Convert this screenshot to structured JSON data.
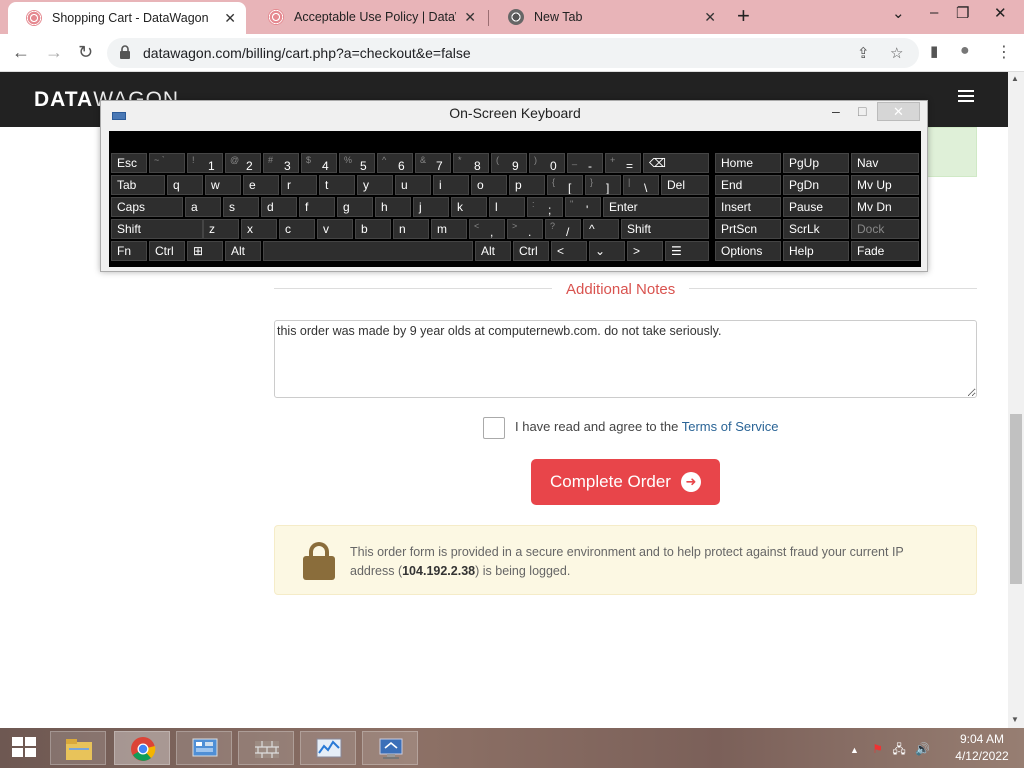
{
  "browser": {
    "tabs": [
      {
        "title": "Shopping Cart - DataWagon",
        "active": true
      },
      {
        "title": "Acceptable Use Policy | DataWa",
        "active": false
      },
      {
        "title": "New Tab",
        "active": false
      }
    ],
    "new_tab": "+",
    "window_controls": {
      "dropdown": "⌄",
      "minimize": "–",
      "restore": "❐",
      "close": "✕"
    },
    "nav": {
      "back": "←",
      "forward": "→",
      "reload": "↻"
    },
    "url": "datawagon.com/billing/cart.php?a=checkout&e=false",
    "omni_icons": {
      "share": "⇪",
      "star": "☆",
      "sidebar": "▮",
      "profile": "●",
      "menu": "⋮"
    },
    "tab_bar_color": "#e8b4b8"
  },
  "site": {
    "logo_a": "DATA",
    "logo_b": "WAGON",
    "notes_heading": "Additional Notes",
    "notes_value": "this order was made by 9 year olds at computernewb.com. do not take seriously.",
    "tos_text": "I have read and agree to the ",
    "tos_link": "Terms of Service",
    "complete_button": "Complete Order",
    "secure_prefix": "This order form is provided in a secure environment and to help protect against fraud your current IP address (",
    "ip_address": "104.192.2.38",
    "secure_suffix": ") is being logged.",
    "accent_color": "#e8454a",
    "heading_color": "#d9534f"
  },
  "osk": {
    "title": "On-Screen Keyboard",
    "controls": {
      "minimize": "–",
      "maximize": "□",
      "close": "✕"
    },
    "rows": [
      [
        {
          "l": "Esc"
        },
        {
          "l": "",
          "a": "~ `"
        },
        {
          "l": "1",
          "a": "!"
        },
        {
          "l": "2",
          "a": "@"
        },
        {
          "l": "3",
          "a": "#"
        },
        {
          "l": "4",
          "a": "$"
        },
        {
          "l": "5",
          "a": "%"
        },
        {
          "l": "6",
          "a": "^"
        },
        {
          "l": "7",
          "a": "&"
        },
        {
          "l": "8",
          "a": "*"
        },
        {
          "l": "9",
          "a": "("
        },
        {
          "l": "0",
          "a": ")"
        },
        {
          "l": "-",
          "a": "_"
        },
        {
          "l": "=",
          "a": "+"
        },
        {
          "l": "⌫"
        }
      ],
      [
        {
          "l": "Tab"
        },
        {
          "l": "q"
        },
        {
          "l": "w"
        },
        {
          "l": "e"
        },
        {
          "l": "r"
        },
        {
          "l": "t"
        },
        {
          "l": "y"
        },
        {
          "l": "u"
        },
        {
          "l": "i"
        },
        {
          "l": "o"
        },
        {
          "l": "p"
        },
        {
          "l": "[",
          "a": "{"
        },
        {
          "l": "]",
          "a": "}"
        },
        {
          "l": "\\",
          "a": "|"
        },
        {
          "l": "Del"
        }
      ],
      [
        {
          "l": "Caps"
        },
        {
          "l": "a"
        },
        {
          "l": "s"
        },
        {
          "l": "d"
        },
        {
          "l": "f"
        },
        {
          "l": "g"
        },
        {
          "l": "h"
        },
        {
          "l": "j"
        },
        {
          "l": "k"
        },
        {
          "l": "l"
        },
        {
          "l": ";",
          "a": ":"
        },
        {
          "l": "'",
          "a": "\""
        },
        {
          "l": "Enter"
        }
      ],
      [
        {
          "l": "Shift"
        },
        {
          "l": "z"
        },
        {
          "l": "x"
        },
        {
          "l": "c"
        },
        {
          "l": "v"
        },
        {
          "l": "b"
        },
        {
          "l": "n"
        },
        {
          "l": "m"
        },
        {
          "l": ",",
          "a": "<"
        },
        {
          "l": ".",
          "a": ">"
        },
        {
          "l": "/",
          "a": "?"
        },
        {
          "l": "^"
        },
        {
          "l": "Shift"
        }
      ],
      [
        {
          "l": "Fn"
        },
        {
          "l": "Ctrl"
        },
        {
          "l": "⊞"
        },
        {
          "l": "Alt"
        },
        {
          "l": ""
        },
        {
          "l": "Alt"
        },
        {
          "l": "Ctrl"
        },
        {
          "l": "<"
        },
        {
          "l": "⌄"
        },
        {
          "l": ">"
        },
        {
          "l": "☰"
        }
      ]
    ],
    "side": [
      [
        "Home",
        "PgUp",
        "Nav"
      ],
      [
        "End",
        "PgDn",
        "Mv Up"
      ],
      [
        "Insert",
        "Pause",
        "Mv Dn"
      ],
      [
        "PrtScn",
        "ScrLk",
        "Dock"
      ],
      [
        "Options",
        "Help",
        "Fade"
      ]
    ]
  },
  "taskbar": {
    "apps": [
      "file-explorer",
      "chrome",
      "control-panel",
      "firewall",
      "performance-monitor",
      "remote-desktop"
    ],
    "tray_arrow": "▲",
    "time": "9:04 AM",
    "date": "4/12/2022"
  }
}
